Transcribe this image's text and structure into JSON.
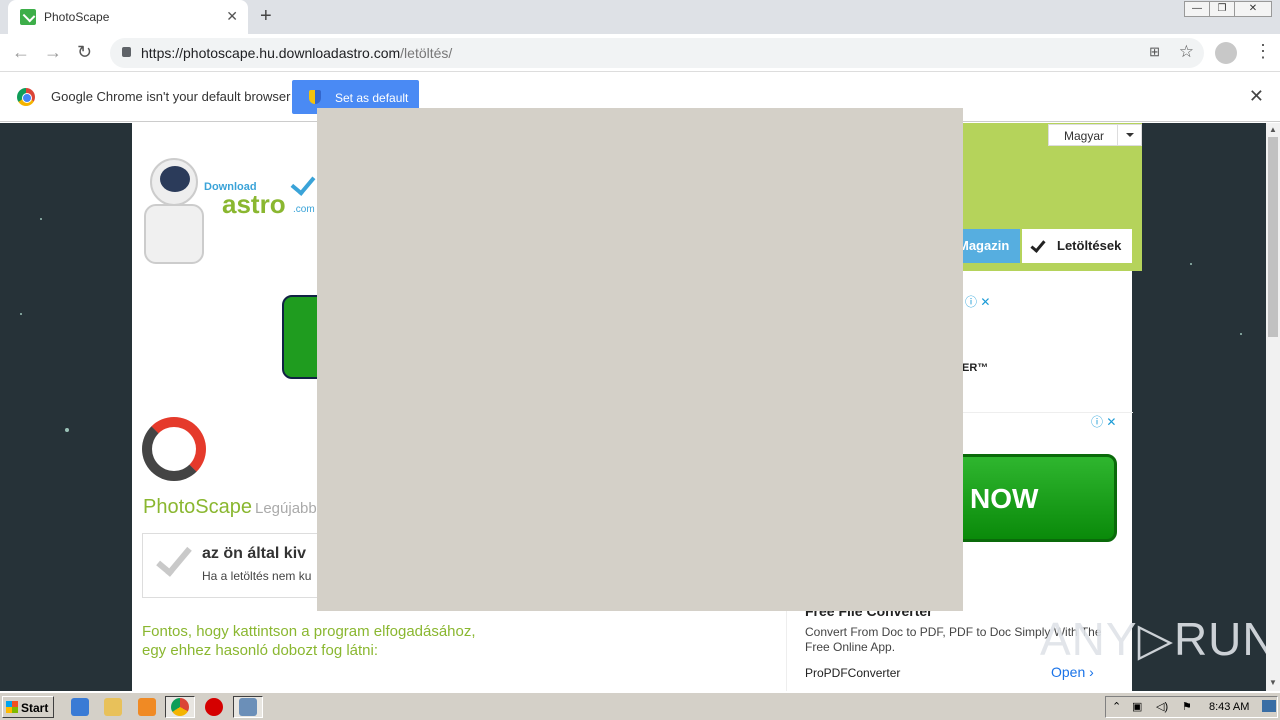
{
  "browser": {
    "tab_title": "PhotoScape",
    "url_host": "https://photoscape.hu.downloadastro.com",
    "url_path": "/letöltés/",
    "new_tab": "+",
    "tab_close": "✕"
  },
  "window": {
    "min": "—",
    "restore": "❐",
    "close": "✕"
  },
  "infobar": {
    "message": "Google Chrome isn't your default browser",
    "button": "Set as default",
    "close": "✕"
  },
  "page": {
    "language": "Magyar",
    "logo": {
      "download": "Download",
      "astro": "astro",
      "com": ".com"
    },
    "tabs": {
      "magazin": "Magazin",
      "letoltesek": "Letöltések"
    },
    "ad1": {
      "brand_fragment": "ER™"
    },
    "ad_now": "NOW",
    "photoscape": {
      "name": "PhotoScape",
      "subtitle": "Legújabb",
      "notice_title": "az ön által kiv",
      "notice_sub": "Ha a letöltés nem ku"
    },
    "fontos_line1": "Fontos, hogy kattintson a program elfogadásához,",
    "fontos_line2": "egy ehhez hasonló dobozt fog látni:",
    "ad2": {
      "title": "Free File Converter",
      "desc": "Convert From Doc to PDF, PDF to Doc Simply With The Free Online App.",
      "brand": "ProPDFConverter",
      "cta": "Open"
    },
    "watermark": "ANY▷RUN"
  },
  "taskbar": {
    "start": "Start",
    "clock": "8:43 AM"
  },
  "colors": {
    "accent_green": "#8ab730",
    "chrome_blue": "#4a8af4",
    "overlay": "#d4d0c8"
  }
}
